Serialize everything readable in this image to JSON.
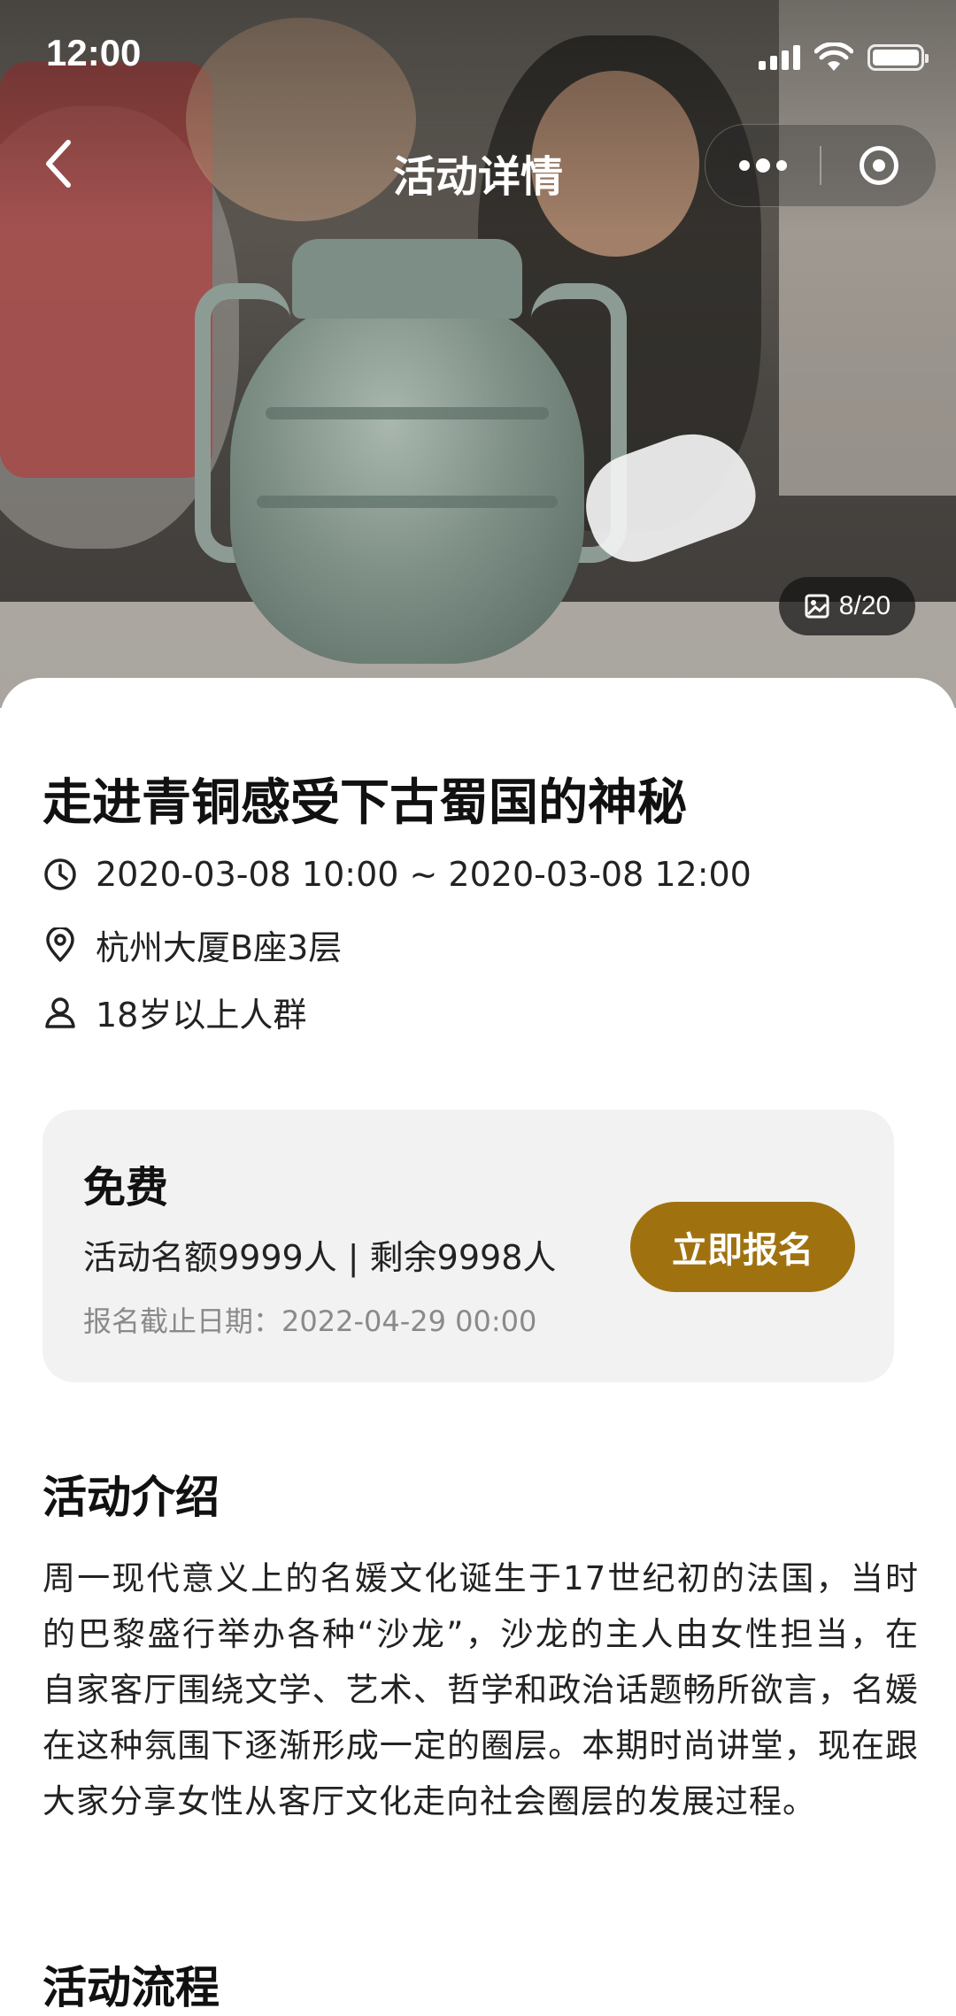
{
  "status_bar": {
    "time": "12:00",
    "signal": "signal-icon",
    "wifi": "wifi-icon",
    "battery": "battery-icon"
  },
  "nav": {
    "title": "活动详情",
    "back_icon": "chevron-left-icon",
    "more_icon": "more-dots-icon",
    "close_icon": "target-icon"
  },
  "hero": {
    "image": "bronze-vessel-photo",
    "counter": "8/20",
    "counter_icon": "gallery-icon"
  },
  "event": {
    "title": "走进青铜感受下古蜀国的神秘",
    "time": "2020-03-08 10:00 ~ 2020-03-08 12:00",
    "location": "杭州大厦B座3层",
    "audience": "18岁以上人群"
  },
  "registration": {
    "price": "免费",
    "quota": "活动名额9999人 | 剩余9998人",
    "deadline": "报名截止日期：2022-04-29 00:00",
    "button": "立即报名"
  },
  "intro": {
    "title": "活动介绍",
    "text": "周一现代意义上的名媛文化诞生于17世纪初的法国，当时的巴黎盛行举办各种“沙龙”，沙龙的主人由女性担当，在自家客厅围绕文学、艺术、哲学和政治话题畅所欲言，名媛在这种氛围下逐渐形成一定的圈层。本期时尚讲堂，现在跟大家分享女性从客厅文化走向社会圈层的发展过程。"
  },
  "next_section": {
    "title": "活动流程"
  },
  "colors": {
    "accent": "#a0720f",
    "panel": "#f2f2f2",
    "muted_text": "#8a8a8a"
  }
}
